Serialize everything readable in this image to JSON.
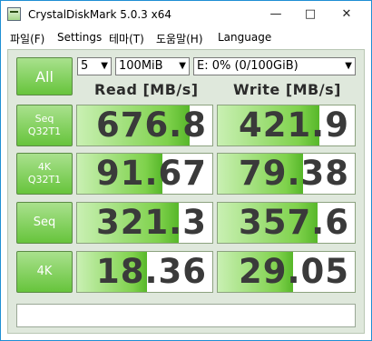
{
  "window": {
    "title": "CrystalDiskMark 5.0.3 x64",
    "minimize": "—",
    "maximize": "□",
    "close": "✕"
  },
  "menu": [
    "파일(F)",
    "Settings",
    "테마(T)",
    "도움말(H)",
    "Language"
  ],
  "controls": {
    "all_label": "All",
    "count": "5",
    "size": "100MiB",
    "drive": "E: 0% (0/100GiB)"
  },
  "headers": {
    "read": "Read [MB/s]",
    "write": "Write [MB/s]"
  },
  "tests": [
    {
      "label_line1": "Seq",
      "label_line2": "Q32T1",
      "read": "676.8",
      "write": "421.9",
      "read_fill": 0.83,
      "write_fill": 0.74
    },
    {
      "label_line1": "4K",
      "label_line2": "Q32T1",
      "read": "91.67",
      "write": "79.38",
      "read_fill": 0.63,
      "write_fill": 0.62
    },
    {
      "label_line1": "Seq",
      "label_line2": "",
      "read": "321.3",
      "write": "357.6",
      "read_fill": 0.75,
      "write_fill": 0.73
    },
    {
      "label_line1": "4K",
      "label_line2": "",
      "read": "18.36",
      "write": "29.05",
      "read_fill": 0.52,
      "write_fill": 0.55
    }
  ],
  "comment": ""
}
